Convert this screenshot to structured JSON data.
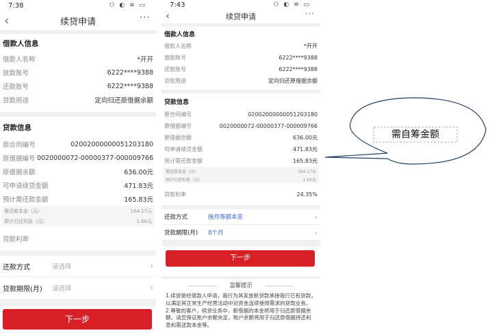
{
  "left": {
    "status": {
      "time": "7:38",
      "icons": "⚇ ◐ ≋ ▭"
    },
    "nav": {
      "title": "续贷申请",
      "more": "···"
    },
    "borrower": {
      "title": "借款人信息",
      "rows": [
        {
          "label": "借款人名称",
          "value": "*开开"
        },
        {
          "label": "放款账号",
          "value": "6222****9388"
        },
        {
          "label": "还款账号",
          "value": "6222****9388"
        },
        {
          "label": "贷款用途",
          "value": "定向归还原借据余额"
        }
      ]
    },
    "loan": {
      "title": "贷款信息",
      "rows": [
        {
          "label": "原合同编号",
          "value": "02002000000051203180"
        },
        {
          "label": "原借据编号",
          "value": "0020000072-00000377-000009766"
        },
        {
          "label": "原借据余额",
          "value": "636.00元"
        },
        {
          "label": "可申请续贷金额",
          "value": "471.83元"
        },
        {
          "label": "预计需还款金额",
          "value": "165.83元"
        }
      ],
      "sub_rows": [
        {
          "label": "需还款本金（元）",
          "value": "164.17元"
        },
        {
          "label": "预计归还利息（元）",
          "value": "1.66元"
        }
      ],
      "rate_label": "贷款利率"
    },
    "repay_method": {
      "label": "还款方式",
      "value": "请选择"
    },
    "term": {
      "label": "贷款期限(月)",
      "value": "请选择"
    },
    "next_label": "下一步"
  },
  "right": {
    "status": {
      "time": "7:43",
      "icons": "⚇ ◐ ≋ ▭"
    },
    "nav": {
      "title": "续贷申请",
      "more": "···"
    },
    "borrower": {
      "title": "借款人信息",
      "rows": [
        {
          "label": "借款人名称",
          "value": "*开开"
        },
        {
          "label": "放款账号",
          "value": "6222****9388"
        },
        {
          "label": "还款账号",
          "value": "6222****9388"
        },
        {
          "label": "贷款用途",
          "value": "定向归还原借据余额"
        }
      ]
    },
    "loan": {
      "title": "贷款信息",
      "rows": [
        {
          "label": "原合同编号",
          "value": "02002000000051203180"
        },
        {
          "label": "原借据编号",
          "value": "0020000072-00000377-000009766"
        },
        {
          "label": "原借据余额",
          "value": "636.00元"
        },
        {
          "label": "可申请续贷金额",
          "value": "471.83元"
        },
        {
          "label": "预计需还款金额",
          "value": "165.83元"
        }
      ],
      "sub_rows": [
        {
          "label": "需还款本金（元）",
          "value": "164.17元"
        },
        {
          "label": "预计归还利息（元）",
          "value": "1.66元"
        }
      ],
      "rate": {
        "label": "贷款利率",
        "value": "24.35%"
      }
    },
    "repay_method": {
      "label": "还款方式",
      "value": "按月等额本息"
    },
    "term": {
      "label": "贷款期限(月)",
      "value": "8个月"
    },
    "next_label": "下一步",
    "tips": {
      "title": "温馨提示",
      "p1": "1.续贷是经借款人申请，我行为其发放新贷款承接我行已有贷款，以满足其正常生产经营活动中对资金连续使用需求的贷款业务。",
      "p2": "2.尊敬的客户，续贷业务中，新借据的本金将用于归还原借据余额，请您保证账户余额充足，账户余额将用于归还原借据待还利息和需还款本金等。"
    }
  },
  "callout": {
    "text": "需自筹金额"
  },
  "colors": {
    "accent": "#d71f26",
    "section_bg": "#f1f1f1",
    "link_blue": "#3d6fd1"
  }
}
